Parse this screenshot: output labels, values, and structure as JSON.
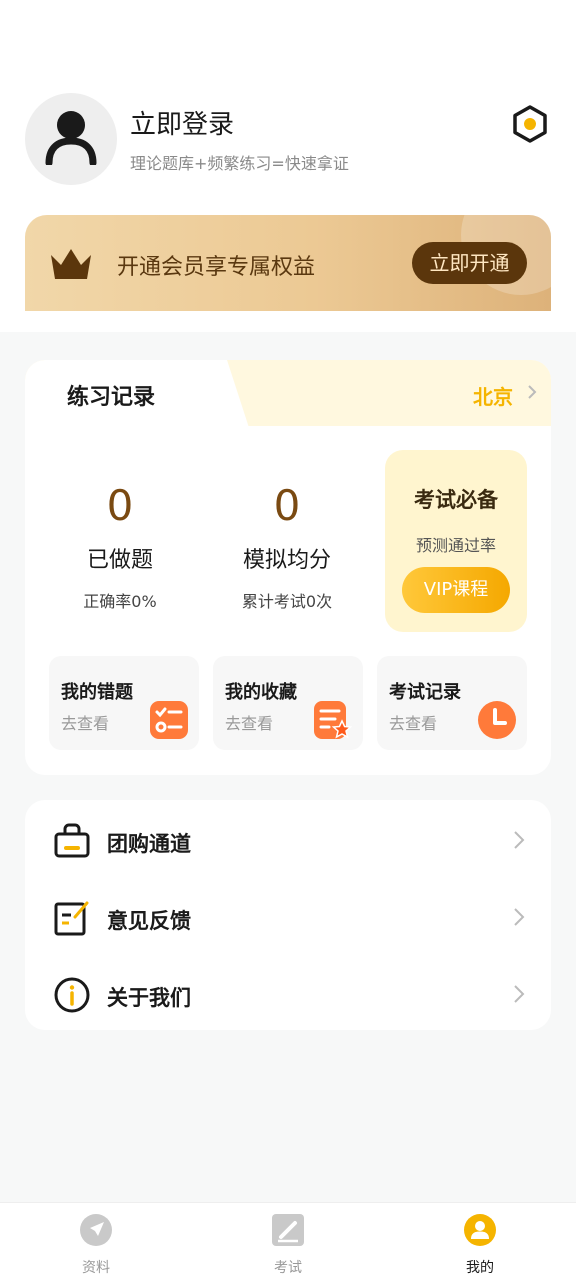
{
  "profile": {
    "login_title": "立即登录",
    "login_subtitle": "理论题库+频繁练习=快速拿证"
  },
  "vip_banner": {
    "text": "开通会员享专属权益",
    "button_label": "立即开通"
  },
  "practice": {
    "tab_title": "练习记录",
    "region": "北京",
    "stats": [
      {
        "value": "0",
        "label": "已做题",
        "sub": "正确率0%"
      },
      {
        "value": "0",
        "label": "模拟均分",
        "sub": "累计考试0次"
      }
    ],
    "exam_box": {
      "title": "考试必备",
      "subtitle": "预测通过率",
      "button_label": "VIP课程"
    },
    "quick_links": [
      {
        "title": "我的错题",
        "sub": "去查看",
        "icon": "wrong-questions-icon"
      },
      {
        "title": "我的收藏",
        "sub": "去查看",
        "icon": "favorites-icon"
      },
      {
        "title": "考试记录",
        "sub": "去查看",
        "icon": "clock-icon"
      }
    ]
  },
  "menu": {
    "items": [
      {
        "label": "团购通道",
        "icon": "shopping-bag-icon"
      },
      {
        "label": "意见反馈",
        "icon": "feedback-icon"
      },
      {
        "label": "关于我们",
        "icon": "info-icon"
      }
    ]
  },
  "bottom_nav": {
    "items": [
      {
        "label": "资料",
        "icon": "navigation-icon"
      },
      {
        "label": "考试",
        "icon": "exam-icon"
      },
      {
        "label": "我的",
        "icon": "profile-icon"
      }
    ],
    "active": "我的"
  },
  "colors": {
    "accent": "#f5b400",
    "vip_dark": "#5b360c",
    "stat_number": "#7a4a12"
  }
}
